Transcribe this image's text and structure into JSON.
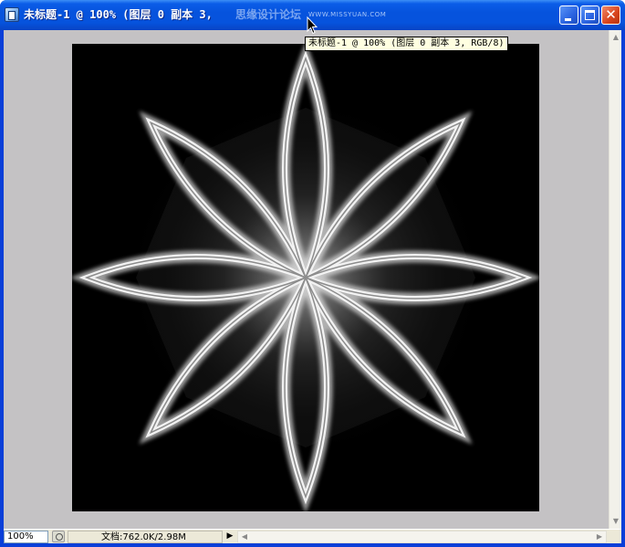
{
  "window": {
    "title": "未标题-1 @ 100% (图层 0 副本 3, RGB/8)",
    "title_visible": "未标题-1 @ 100% (图层 0 副本 3,",
    "watermark": "思缘设计论坛",
    "watermark_url": "WWW.MISSYUAN.COM",
    "buttons": {
      "minimize_icon": "minimize-icon",
      "maximize_icon": "maximize-icon",
      "close_icon": "close-icon",
      "close_glyph": "✕"
    }
  },
  "tooltip": {
    "text": "未标题-1 @ 100% (图层 0 副本 3, RGB/8)"
  },
  "status": {
    "zoom": "100%",
    "doc_info": "文档:762.0K/2.98M",
    "arrow_glyph": "▶"
  },
  "scroll": {
    "up": "▲",
    "down": "▼",
    "left": "◀",
    "right": "▶"
  },
  "colors": {
    "titlebar": "#0653dd",
    "workspace": "#c4c2c4",
    "canvas_bg": "#000000",
    "tooltip_bg": "#ffffe1",
    "statusbar": "#ece9d8",
    "close_button": "#d8431c"
  },
  "canvas": {
    "artwork": "white glowing eight-petal star flower on black"
  }
}
